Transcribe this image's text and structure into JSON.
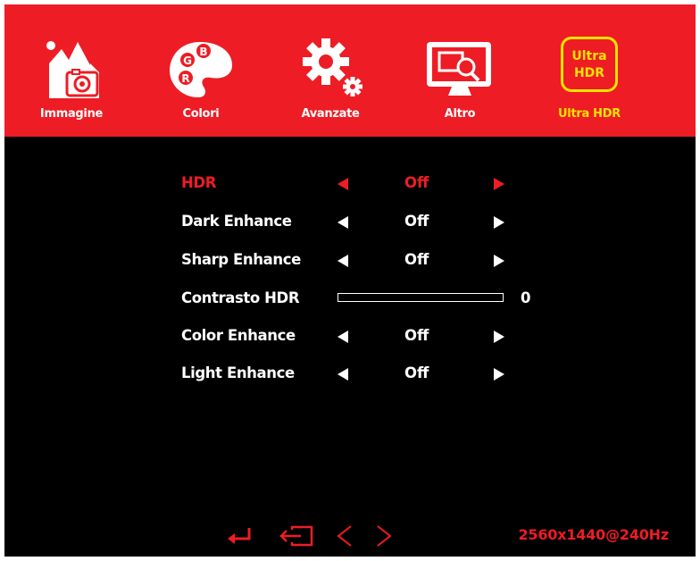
{
  "tabs": [
    {
      "label": "Immagine",
      "icon": "picture-icon"
    },
    {
      "label": "Colori",
      "icon": "palette-icon"
    },
    {
      "label": "Avanzate",
      "icon": "gears-icon"
    },
    {
      "label": "Altro",
      "icon": "monitor-search-icon"
    },
    {
      "label": "Ultra HDR",
      "icon": "ultra-hdr-icon",
      "icon_text": [
        "Ultra",
        "HDR"
      ],
      "active": true
    }
  ],
  "palette_letters": [
    "G",
    "B",
    "R"
  ],
  "settings": [
    {
      "name": "HDR",
      "value": "Off",
      "selected": true
    },
    {
      "name": "Dark Enhance",
      "value": "Off"
    },
    {
      "name": "Sharp Enhance",
      "value": "Off"
    },
    {
      "name": "Contrasto HDR",
      "slider_value": "0",
      "level": 0
    },
    {
      "name": "Color Enhance",
      "value": "Off"
    },
    {
      "name": "Light Enhance",
      "value": "Off"
    }
  ],
  "bottom_controls": [
    {
      "icon": "enter-icon"
    },
    {
      "icon": "exit-icon"
    },
    {
      "icon": "previous-icon"
    },
    {
      "icon": "next-icon"
    }
  ],
  "status": {
    "resolution": "2560x1440@240Hz"
  },
  "colors": {
    "accent": "#ee1c24",
    "highlight": "#ffe400",
    "background": "#000000",
    "text": "#ffffff"
  }
}
